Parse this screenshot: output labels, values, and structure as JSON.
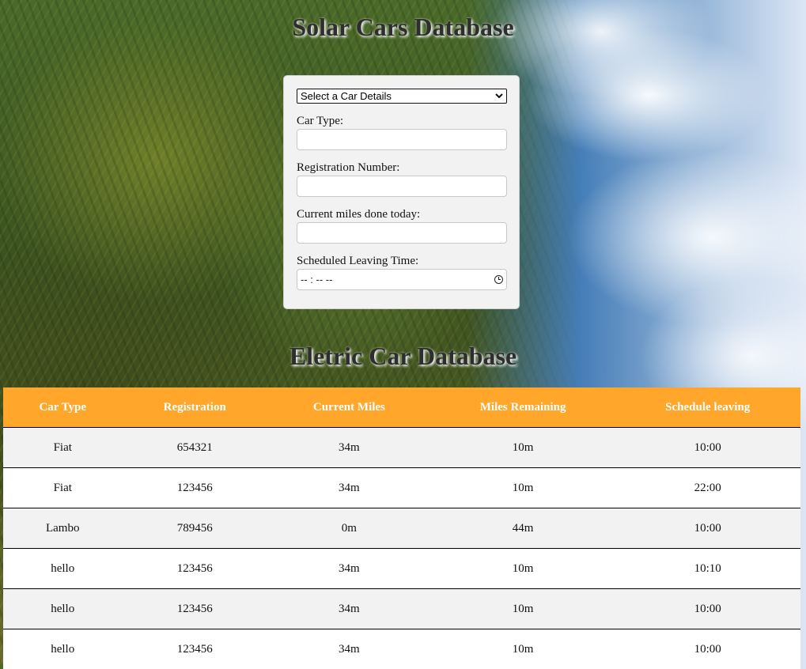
{
  "header": {
    "title": "Solar Cars Database"
  },
  "form": {
    "select_value": "Select a Car Details",
    "car_type_label": "Car Type:",
    "car_type_value": "",
    "registration_label": "Registration Number:",
    "registration_value": "",
    "miles_label": "Current miles done today:",
    "miles_value": "",
    "leaving_label": "Scheduled Leaving Time:",
    "leaving_placeholder": "-- : --  --"
  },
  "table_section": {
    "title": "Eletric Car Database"
  },
  "table": {
    "headers": [
      "Car Type",
      "Registration",
      "Current Miles",
      "Miles Remaining",
      "Schedule leaving"
    ],
    "rows": [
      [
        "Fiat",
        "654321",
        "34m",
        "10m",
        "10:00"
      ],
      [
        "Fiat",
        "123456",
        "34m",
        "10m",
        "22:00"
      ],
      [
        "Lambo",
        "789456",
        "0m",
        "44m",
        "10:00"
      ],
      [
        "hello",
        "123456",
        "34m",
        "10m",
        "10:10"
      ],
      [
        "hello",
        "123456",
        "34m",
        "10m",
        "10:00"
      ],
      [
        "hello",
        "123456",
        "34m",
        "10m",
        "10:00"
      ]
    ]
  },
  "colors": {
    "table_header": "#ffa62b",
    "panel_bg": "#f2f2f2",
    "row_alt": "#f2f2f2"
  },
  "icons": {
    "time_picker": "clock-icon",
    "select_arrow": "chevron-down-icon"
  }
}
